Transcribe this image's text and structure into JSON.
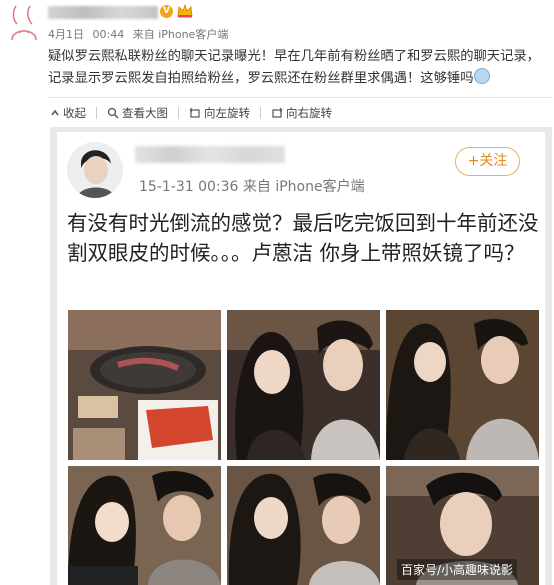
{
  "post": {
    "date": "4月1日",
    "time": "00:44",
    "source": "来自 iPhone客户端",
    "body": "疑似罗云熙私联粉丝的聊天记录曝光！早在几年前有粉丝晒了和罗云熙的聊天记录，记录显示罗云熙发自拍照给粉丝，罗云熙还在粉丝群里求偶遇！这够锤吗"
  },
  "toolbar": {
    "collapse": "收起",
    "view_large": "查看大图",
    "rotate_left": "向左旋转",
    "rotate_right": "向右旋转"
  },
  "embedded": {
    "meta": "15-1-31 00:36  来自 iPhone客户端",
    "follow": "+关注",
    "text": "有没有时光倒流的感觉？最后吃完饭回到十年前还没割双眼皮的时候。。。卢蒽洁 你身上带照妖镜了吗？"
  },
  "watermark": "百家号/小高趣味说影",
  "colors": {
    "follow_border": "#e8b35c",
    "follow_text": "#e08a1c",
    "badge": "#f7a21b"
  }
}
